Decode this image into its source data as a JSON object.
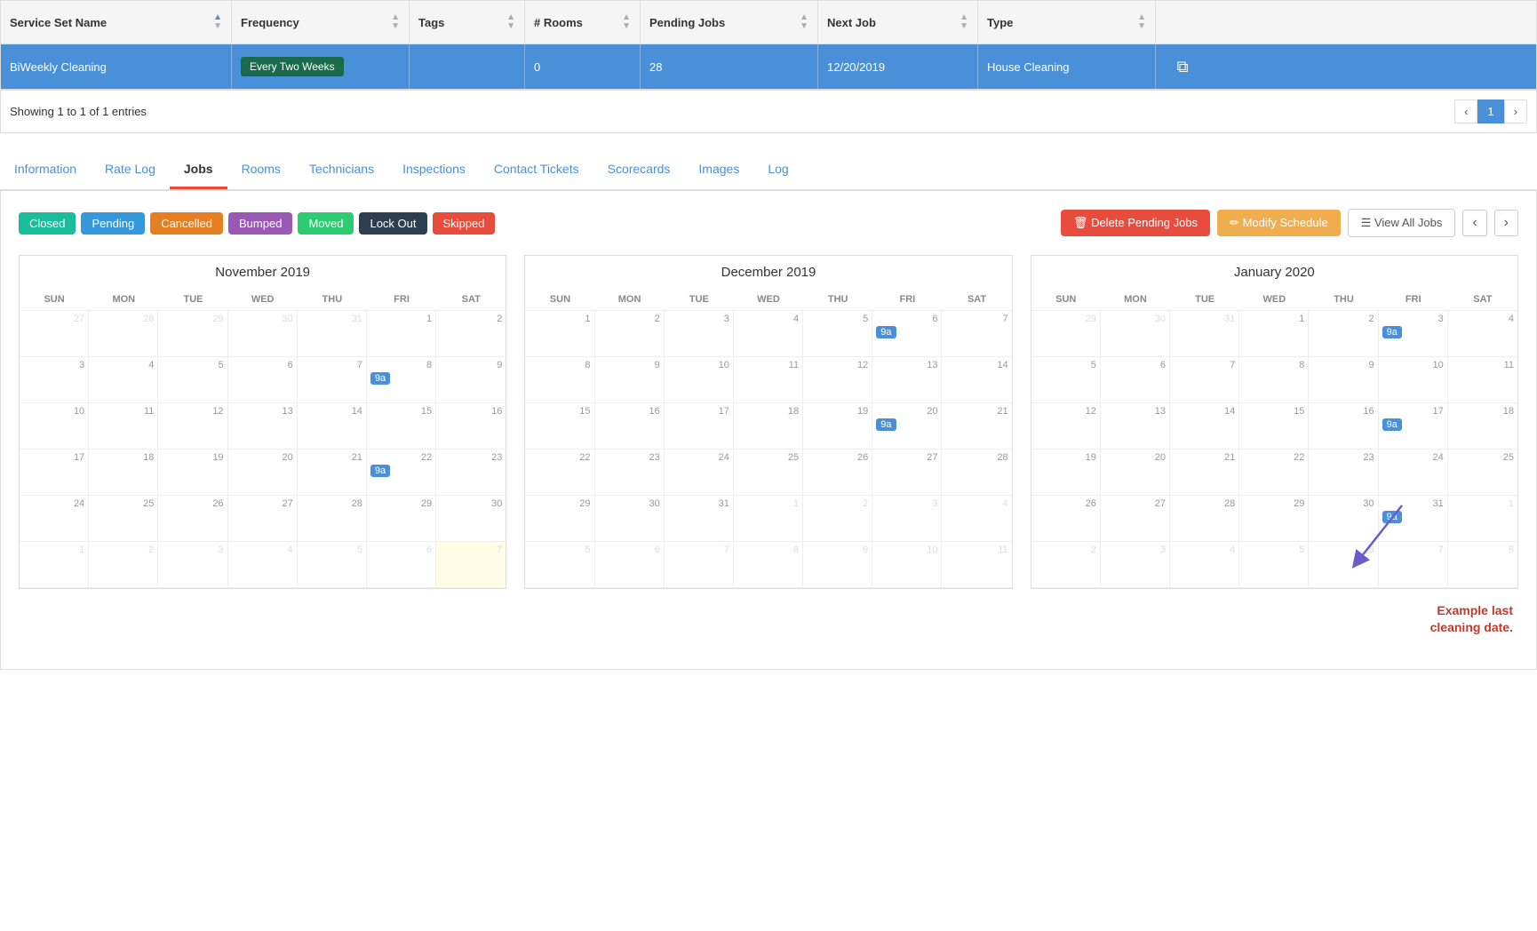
{
  "table": {
    "headers": [
      {
        "label": "Service Set Name",
        "key": "service_set_name"
      },
      {
        "label": "Frequency",
        "key": "frequency"
      },
      {
        "label": "Tags",
        "key": "tags"
      },
      {
        "label": "# Rooms",
        "key": "rooms"
      },
      {
        "label": "Pending Jobs",
        "key": "pending_jobs"
      },
      {
        "label": "Next Job",
        "key": "next_job"
      },
      {
        "label": "Type",
        "key": "type"
      },
      {
        "label": "",
        "key": "action"
      }
    ],
    "row": {
      "service_set_name": "BiWeekly Cleaning",
      "frequency": "Every Two Weeks",
      "tags": "",
      "rooms": "0",
      "pending_jobs": "28",
      "next_job": "12/20/2019",
      "type": "House Cleaning"
    },
    "showing": "Showing 1 to 1 of 1 entries",
    "page": "1"
  },
  "tabs": [
    {
      "label": "Information",
      "active": false
    },
    {
      "label": "Rate Log",
      "active": false
    },
    {
      "label": "Jobs",
      "active": true
    },
    {
      "label": "Rooms",
      "active": false
    },
    {
      "label": "Technicians",
      "active": false
    },
    {
      "label": "Inspections",
      "active": false
    },
    {
      "label": "Contact Tickets",
      "active": false
    },
    {
      "label": "Scorecards",
      "active": false
    },
    {
      "label": "Images",
      "active": false
    },
    {
      "label": "Log",
      "active": false
    }
  ],
  "legend": [
    {
      "label": "Closed",
      "class": "l-closed"
    },
    {
      "label": "Pending",
      "class": "l-pending"
    },
    {
      "label": "Cancelled",
      "class": "l-cancelled"
    },
    {
      "label": "Bumped",
      "class": "l-bumped"
    },
    {
      "label": "Moved",
      "class": "l-moved"
    },
    {
      "label": "Lock Out",
      "class": "l-lockout"
    },
    {
      "label": "Skipped",
      "class": "l-skipped"
    }
  ],
  "buttons": {
    "delete": "Delete Pending Jobs",
    "modify": "Modify Schedule",
    "view_all": "View All Jobs"
  },
  "calendars": [
    {
      "title": "November 2019",
      "dows": [
        "SUN",
        "MON",
        "TUE",
        "WED",
        "THU",
        "FRI",
        "SAT"
      ],
      "weeks": [
        [
          {
            "num": "27",
            "other": true
          },
          {
            "num": "28",
            "other": true
          },
          {
            "num": "29",
            "other": true
          },
          {
            "num": "30",
            "other": true
          },
          {
            "num": "31",
            "other": true
          },
          {
            "num": "1",
            "job": null
          },
          {
            "num": "2",
            "job": null
          }
        ],
        [
          {
            "num": "3"
          },
          {
            "num": "4"
          },
          {
            "num": "5"
          },
          {
            "num": "6"
          },
          {
            "num": "7"
          },
          {
            "num": "8",
            "job": "9a"
          },
          {
            "num": "9"
          }
        ],
        [
          {
            "num": "10"
          },
          {
            "num": "11"
          },
          {
            "num": "12"
          },
          {
            "num": "13"
          },
          {
            "num": "14"
          },
          {
            "num": "15"
          },
          {
            "num": "16"
          }
        ],
        [
          {
            "num": "17"
          },
          {
            "num": "18"
          },
          {
            "num": "19"
          },
          {
            "num": "20"
          },
          {
            "num": "21"
          },
          {
            "num": "22",
            "job": "9a"
          },
          {
            "num": "23"
          }
        ],
        [
          {
            "num": "24"
          },
          {
            "num": "25"
          },
          {
            "num": "26"
          },
          {
            "num": "27"
          },
          {
            "num": "28"
          },
          {
            "num": "29"
          },
          {
            "num": "30"
          }
        ],
        [
          {
            "num": "1",
            "other": true
          },
          {
            "num": "2",
            "other": true
          },
          {
            "num": "3",
            "other": true
          },
          {
            "num": "4",
            "other": true
          },
          {
            "num": "5",
            "other": true
          },
          {
            "num": "6",
            "other": true
          },
          {
            "num": "7",
            "highlighted": true,
            "other": true
          }
        ]
      ]
    },
    {
      "title": "December 2019",
      "dows": [
        "SUN",
        "MON",
        "TUE",
        "WED",
        "THU",
        "FRI",
        "SAT"
      ],
      "weeks": [
        [
          {
            "num": "1"
          },
          {
            "num": "2"
          },
          {
            "num": "3"
          },
          {
            "num": "4"
          },
          {
            "num": "5"
          },
          {
            "num": "6",
            "job": "9a"
          },
          {
            "num": "7"
          }
        ],
        [
          {
            "num": "8"
          },
          {
            "num": "9"
          },
          {
            "num": "10"
          },
          {
            "num": "11"
          },
          {
            "num": "12"
          },
          {
            "num": "13"
          },
          {
            "num": "14"
          }
        ],
        [
          {
            "num": "15"
          },
          {
            "num": "16"
          },
          {
            "num": "17"
          },
          {
            "num": "18"
          },
          {
            "num": "19"
          },
          {
            "num": "20",
            "job": "9a"
          },
          {
            "num": "21"
          }
        ],
        [
          {
            "num": "22"
          },
          {
            "num": "23"
          },
          {
            "num": "24"
          },
          {
            "num": "25"
          },
          {
            "num": "26"
          },
          {
            "num": "27"
          },
          {
            "num": "28"
          }
        ],
        [
          {
            "num": "29"
          },
          {
            "num": "30"
          },
          {
            "num": "31"
          },
          {
            "num": "1",
            "other": true
          },
          {
            "num": "2",
            "other": true
          },
          {
            "num": "3",
            "other": true
          },
          {
            "num": "4",
            "other": true
          }
        ],
        [
          {
            "num": "5",
            "other": true
          },
          {
            "num": "6",
            "other": true
          },
          {
            "num": "7",
            "other": true
          },
          {
            "num": "8",
            "other": true
          },
          {
            "num": "9",
            "other": true
          },
          {
            "num": "10",
            "other": true
          },
          {
            "num": "11",
            "other": true
          }
        ]
      ]
    },
    {
      "title": "January 2020",
      "dows": [
        "SUN",
        "MON",
        "TUE",
        "WED",
        "THU",
        "FRI",
        "SAT"
      ],
      "weeks": [
        [
          {
            "num": "29",
            "other": true
          },
          {
            "num": "30",
            "other": true
          },
          {
            "num": "31",
            "other": true
          },
          {
            "num": "1"
          },
          {
            "num": "2"
          },
          {
            "num": "3",
            "job": "9a"
          },
          {
            "num": "4"
          }
        ],
        [
          {
            "num": "5"
          },
          {
            "num": "6"
          },
          {
            "num": "7"
          },
          {
            "num": "8"
          },
          {
            "num": "9"
          },
          {
            "num": "10"
          },
          {
            "num": "11"
          }
        ],
        [
          {
            "num": "12"
          },
          {
            "num": "13"
          },
          {
            "num": "14"
          },
          {
            "num": "15"
          },
          {
            "num": "16"
          },
          {
            "num": "17",
            "job": "9a"
          },
          {
            "num": "18"
          }
        ],
        [
          {
            "num": "19"
          },
          {
            "num": "20"
          },
          {
            "num": "21"
          },
          {
            "num": "22"
          },
          {
            "num": "23"
          },
          {
            "num": "24"
          },
          {
            "num": "25"
          }
        ],
        [
          {
            "num": "26"
          },
          {
            "num": "27"
          },
          {
            "num": "28"
          },
          {
            "num": "29"
          },
          {
            "num": "30"
          },
          {
            "num": "31",
            "job": "9a"
          },
          {
            "num": "1",
            "other": true
          }
        ],
        [
          {
            "num": "2",
            "other": true
          },
          {
            "num": "3",
            "other": true
          },
          {
            "num": "4",
            "other": true
          },
          {
            "num": "5",
            "other": true
          },
          {
            "num": "6",
            "other": true
          },
          {
            "num": "7",
            "other": true
          },
          {
            "num": "8",
            "other": true
          }
        ]
      ]
    }
  ],
  "annotation": {
    "text": "Example last\ncleaning date.",
    "color": "#c0392b"
  }
}
